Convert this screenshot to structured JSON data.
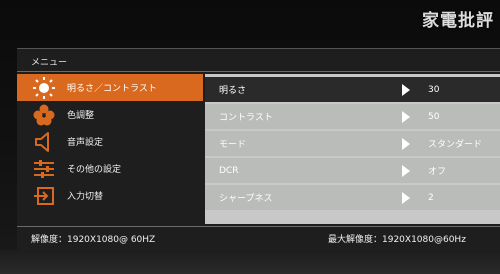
{
  "watermark": "家電批評",
  "osd": {
    "title": "メニュー",
    "menu": [
      {
        "label": "明るさ／コントラスト",
        "icon": "sun-icon",
        "active": true
      },
      {
        "label": "色調整",
        "icon": "color-dots-icon",
        "active": false
      },
      {
        "label": "音声設定",
        "icon": "speaker-icon",
        "active": false
      },
      {
        "label": "その他の設定",
        "icon": "sliders-icon",
        "active": false
      },
      {
        "label": "入力切替",
        "icon": "input-switch-icon",
        "active": false
      }
    ],
    "settings": [
      {
        "label": "明るさ",
        "value": "30"
      },
      {
        "label": "コントラスト",
        "value": "50"
      },
      {
        "label": "モード",
        "value": "スタンダード"
      },
      {
        "label": "DCR",
        "value": "オフ"
      },
      {
        "label": "シャープネス",
        "value": "2"
      }
    ],
    "footer": {
      "resolution": "解像度：1920X1080@ 60HZ",
      "max_resolution": "最大解像度：1920X1080@60Hz"
    },
    "colors": {
      "accent": "#d8691e",
      "panel": "#b9bcb9",
      "dark_row": "#2a2a2a"
    }
  }
}
